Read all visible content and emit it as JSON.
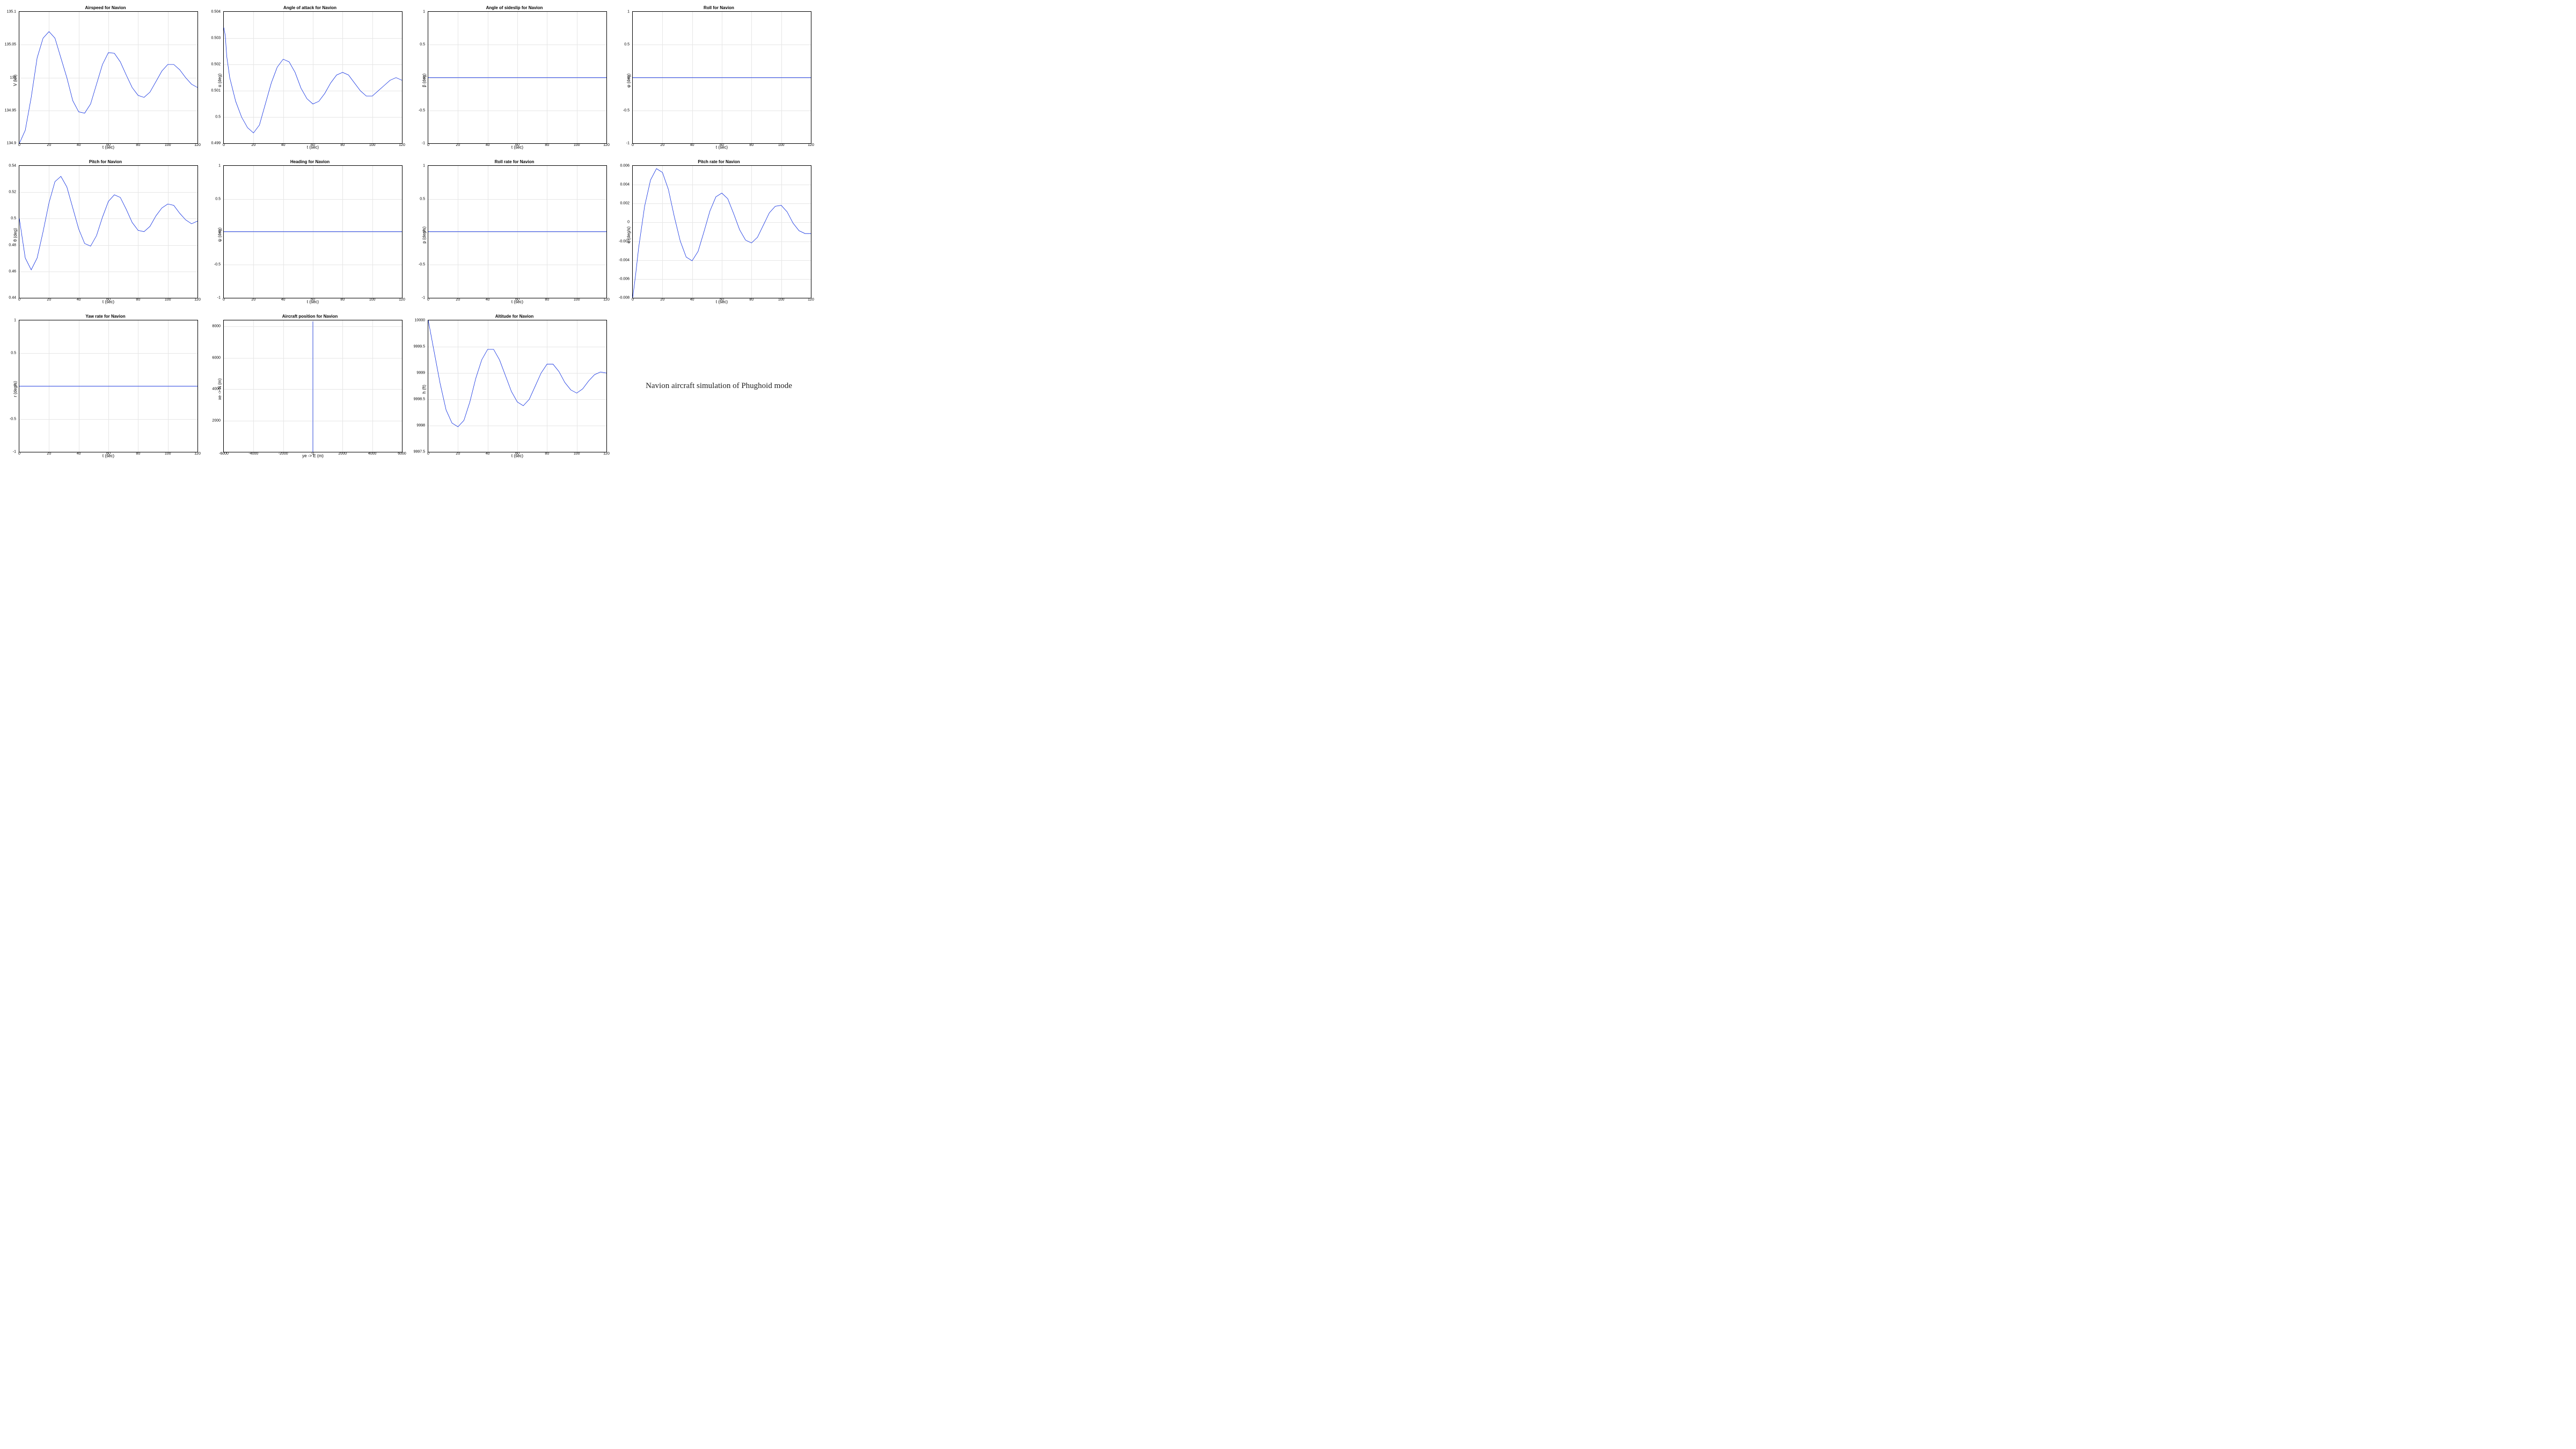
{
  "caption": "Navion aircraft simulation of Phughoid mode",
  "line_color": "#0b2be0",
  "chart_data": [
    {
      "id": "airspeed",
      "type": "line",
      "title": "Airspeed for Navion",
      "xlabel": "t (sec)",
      "ylabel": "V (kn)",
      "xlim": [
        0,
        120
      ],
      "ylim": [
        134.9,
        135.1
      ],
      "xticks": [
        0,
        20,
        40,
        60,
        80,
        100,
        120
      ],
      "yticks": [
        134.9,
        134.95,
        135,
        135.05,
        135.1
      ],
      "x": [
        0,
        4,
        8,
        12,
        16,
        20,
        24,
        28,
        32,
        36,
        40,
        44,
        48,
        52,
        56,
        60,
        64,
        68,
        72,
        76,
        80,
        84,
        88,
        92,
        96,
        100,
        104,
        108,
        112,
        116,
        120
      ],
      "values": [
        134.9,
        134.92,
        134.97,
        135.03,
        135.06,
        135.07,
        135.06,
        135.03,
        135.0,
        134.965,
        134.948,
        134.946,
        134.96,
        134.99,
        135.02,
        135.038,
        135.037,
        135.024,
        135.004,
        134.985,
        134.973,
        134.97,
        134.978,
        134.994,
        135.01,
        135.02,
        135.02,
        135.012,
        135.0,
        134.99,
        134.985
      ]
    },
    {
      "id": "alpha",
      "type": "line",
      "title": "Angle of attack for Navion",
      "xlabel": "t (sec)",
      "ylabel": "α (deg)",
      "xlim": [
        0,
        120
      ],
      "ylim": [
        0.499,
        0.504
      ],
      "xticks": [
        0,
        20,
        40,
        60,
        80,
        100,
        120
      ],
      "yticks": [
        0.499,
        0.5,
        0.501,
        0.502,
        0.503,
        0.504
      ],
      "x": [
        0,
        1,
        2,
        4,
        8,
        12,
        16,
        20,
        24,
        28,
        32,
        36,
        40,
        44,
        48,
        52,
        56,
        60,
        64,
        68,
        72,
        76,
        80,
        84,
        88,
        92,
        96,
        100,
        104,
        108,
        112,
        116,
        120
      ],
      "values": [
        0.5034,
        0.5031,
        0.5023,
        0.5015,
        0.5006,
        0.5,
        0.4996,
        0.4994,
        0.4997,
        0.5005,
        0.5013,
        0.5019,
        0.5022,
        0.5021,
        0.5017,
        0.5011,
        0.5007,
        0.5005,
        0.5006,
        0.5009,
        0.5013,
        0.5016,
        0.5017,
        0.5016,
        0.5013,
        0.501,
        0.5008,
        0.5008,
        0.501,
        0.5012,
        0.5014,
        0.5015,
        0.5014
      ]
    },
    {
      "id": "beta",
      "type": "line",
      "title": "Angle of sideslip for Navion",
      "xlabel": "t (sec)",
      "ylabel": "β (deg)",
      "xlim": [
        0,
        120
      ],
      "ylim": [
        -1,
        1
      ],
      "xticks": [
        0,
        20,
        40,
        60,
        80,
        100,
        120
      ],
      "yticks": [
        -1,
        -0.5,
        0,
        0.5,
        1
      ],
      "x": [
        0,
        120
      ],
      "values": [
        0,
        0
      ]
    },
    {
      "id": "roll",
      "type": "line",
      "title": "Roll for Navion",
      "xlabel": "t (sec)",
      "ylabel": "φ (deg)",
      "xlim": [
        0,
        120
      ],
      "ylim": [
        -1,
        1
      ],
      "xticks": [
        0,
        20,
        40,
        60,
        80,
        100,
        120
      ],
      "yticks": [
        -1,
        -0.5,
        0,
        0.5,
        1
      ],
      "x": [
        0,
        120
      ],
      "values": [
        0,
        0
      ]
    },
    {
      "id": "pitch",
      "type": "line",
      "title": "Pitch for Navion",
      "xlabel": "t (sec)",
      "ylabel": "θ (deg)",
      "xlim": [
        0,
        120
      ],
      "ylim": [
        0.44,
        0.54
      ],
      "xticks": [
        0,
        20,
        40,
        60,
        80,
        100,
        120
      ],
      "yticks": [
        0.44,
        0.46,
        0.48,
        0.5,
        0.52,
        0.54
      ],
      "x": [
        0,
        4,
        8,
        12,
        16,
        20,
        24,
        28,
        32,
        36,
        40,
        44,
        48,
        52,
        56,
        60,
        64,
        68,
        72,
        76,
        80,
        84,
        88,
        92,
        96,
        100,
        104,
        108,
        112,
        116,
        120
      ],
      "values": [
        0.5,
        0.47,
        0.461,
        0.47,
        0.49,
        0.512,
        0.528,
        0.532,
        0.524,
        0.508,
        0.492,
        0.481,
        0.479,
        0.487,
        0.501,
        0.513,
        0.518,
        0.516,
        0.507,
        0.497,
        0.491,
        0.49,
        0.494,
        0.502,
        0.508,
        0.511,
        0.51,
        0.504,
        0.499,
        0.496,
        0.498
      ]
    },
    {
      "id": "heading",
      "type": "line",
      "title": "Heading for Navion",
      "xlabel": "t (sec)",
      "ylabel": "ψ (deg)",
      "xlim": [
        0,
        120
      ],
      "ylim": [
        -1,
        1
      ],
      "xticks": [
        0,
        20,
        40,
        60,
        80,
        100,
        120
      ],
      "yticks": [
        -1,
        -0.5,
        0,
        0.5,
        1
      ],
      "x": [
        0,
        120
      ],
      "values": [
        0,
        0
      ]
    },
    {
      "id": "rollrate",
      "type": "line",
      "title": "Roll rate for Navion",
      "xlabel": "t (sec)",
      "ylabel": "p (deg/s)",
      "xlim": [
        0,
        120
      ],
      "ylim": [
        -1,
        1
      ],
      "xticks": [
        0,
        20,
        40,
        60,
        80,
        100,
        120
      ],
      "yticks": [
        -1,
        -0.5,
        0,
        0.5,
        1
      ],
      "x": [
        0,
        120
      ],
      "values": [
        0,
        0
      ]
    },
    {
      "id": "pitchrate",
      "type": "line",
      "title": "Pitch rate for Navion",
      "xlabel": "t (sec)",
      "ylabel": "q (deg/s)",
      "xlim": [
        0,
        120
      ],
      "ylim": [
        -0.008,
        0.006
      ],
      "xticks": [
        0,
        20,
        40,
        60,
        80,
        100,
        120
      ],
      "yticks": [
        -0.008,
        -0.006,
        -0.004,
        -0.002,
        0,
        0.002,
        0.004,
        0.006
      ],
      "x": [
        0,
        2,
        4,
        8,
        12,
        16,
        20,
        24,
        28,
        32,
        36,
        40,
        44,
        48,
        52,
        56,
        60,
        64,
        68,
        72,
        76,
        80,
        84,
        88,
        92,
        96,
        100,
        104,
        108,
        112,
        116,
        120
      ],
      "values": [
        -0.008,
        -0.0055,
        -0.0027,
        0.0017,
        0.0045,
        0.0057,
        0.0053,
        0.0035,
        0.0006,
        -0.002,
        -0.0037,
        -0.0041,
        -0.0031,
        -0.001,
        0.0012,
        0.0027,
        0.0031,
        0.0025,
        0.0009,
        -0.0008,
        -0.0019,
        -0.0022,
        -0.0016,
        -0.0003,
        0.001,
        0.0017,
        0.0018,
        0.0011,
        -0.0001,
        -0.0009,
        -0.0012,
        -0.0012
      ]
    },
    {
      "id": "yawrate",
      "type": "line",
      "title": "Yaw rate for Navion",
      "xlabel": "t (sec)",
      "ylabel": "r (deg/s)",
      "xlim": [
        0,
        120
      ],
      "ylim": [
        -1,
        1
      ],
      "xticks": [
        0,
        20,
        40,
        60,
        80,
        100,
        120
      ],
      "yticks": [
        -1,
        -0.5,
        0,
        0.5,
        1
      ],
      "x": [
        0,
        120
      ],
      "values": [
        0,
        0
      ]
    },
    {
      "id": "position",
      "type": "line",
      "title": "Aircraft position for Navion",
      "xlabel": "ye -> E (m)",
      "ylabel": "xe -> N (m)",
      "xlim": [
        -6000,
        6000
      ],
      "ylim": [
        0,
        8400
      ],
      "xticks": [
        -6000,
        -4000,
        -2000,
        0,
        2000,
        4000,
        6000
      ],
      "yticks": [
        2000,
        4000,
        6000,
        8000
      ],
      "x": [
        0,
        0
      ],
      "values": [
        0,
        8330
      ]
    },
    {
      "id": "altitude",
      "type": "line",
      "title": "Altitude for Navion",
      "xlabel": "t (sec)",
      "ylabel": "h (ft)",
      "xlim": [
        0,
        120
      ],
      "ylim": [
        9997.5,
        10000
      ],
      "xticks": [
        0,
        20,
        40,
        60,
        80,
        100,
        120
      ],
      "yticks": [
        9997.5,
        9998,
        9998.5,
        9999,
        9999.5,
        10000
      ],
      "x": [
        0,
        4,
        8,
        12,
        16,
        20,
        24,
        28,
        32,
        36,
        40,
        44,
        48,
        52,
        56,
        60,
        64,
        68,
        72,
        76,
        80,
        84,
        88,
        92,
        96,
        100,
        104,
        108,
        112,
        116,
        120
      ],
      "values": [
        10000.0,
        9999.4,
        9998.8,
        9998.3,
        9998.05,
        9997.98,
        9998.1,
        9998.45,
        9998.9,
        9999.25,
        9999.45,
        9999.45,
        9999.25,
        9998.95,
        9998.65,
        9998.45,
        9998.38,
        9998.5,
        9998.75,
        9999.0,
        9999.17,
        9999.17,
        9999.03,
        9998.82,
        9998.68,
        9998.62,
        9998.7,
        9998.85,
        9998.97,
        9999.02,
        9999.0
      ]
    }
  ]
}
